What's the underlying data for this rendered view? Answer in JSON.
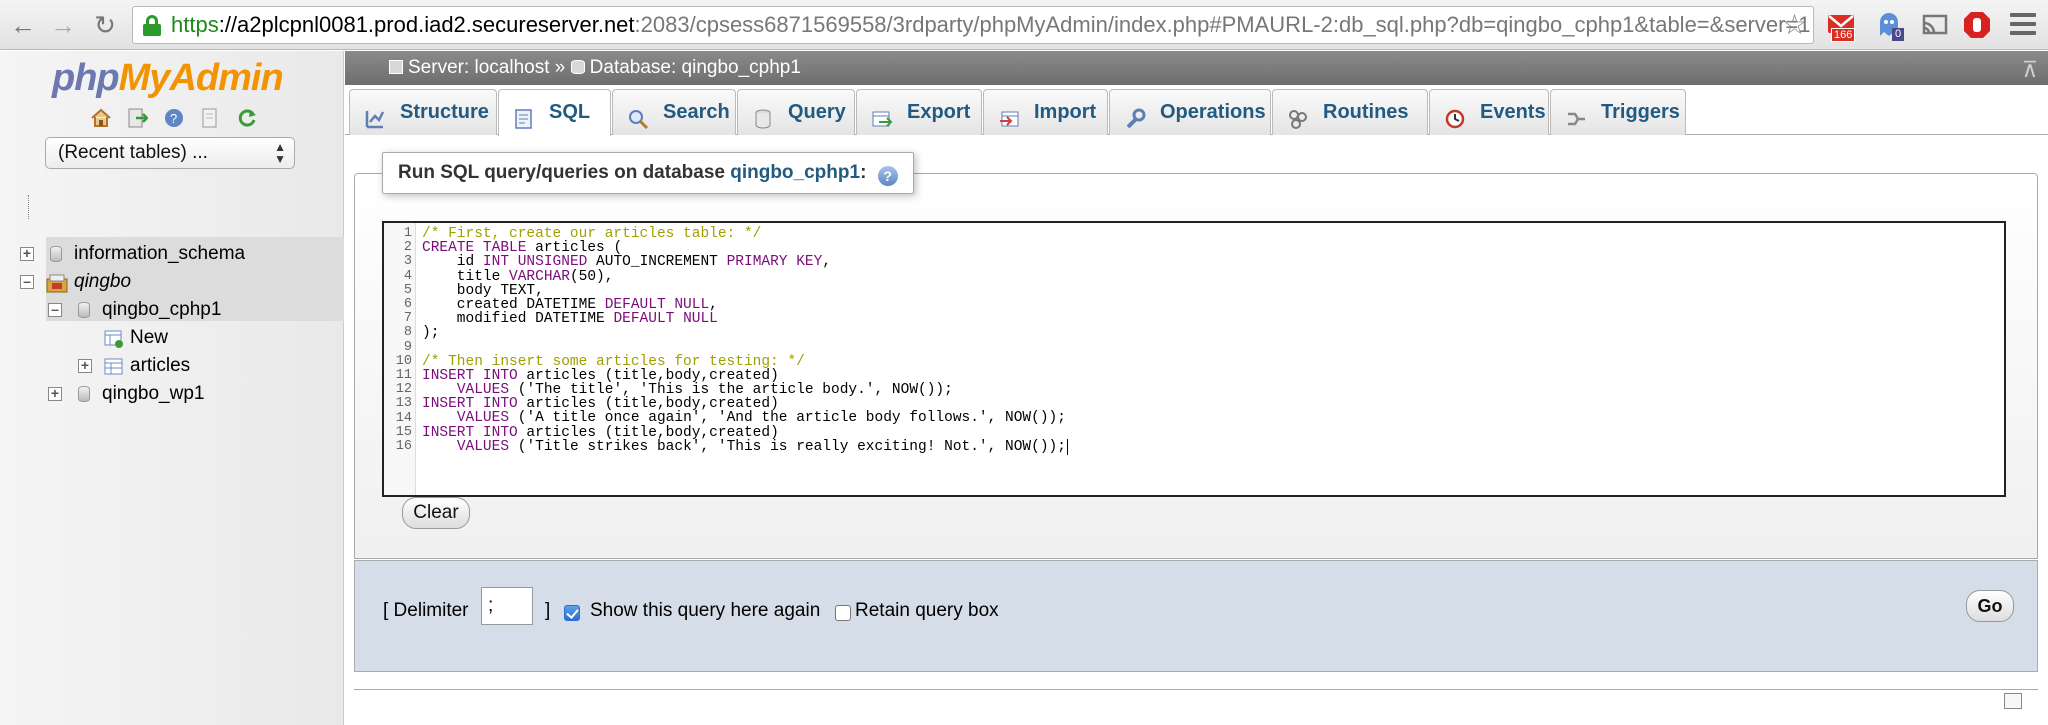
{
  "browser": {
    "url_https": "https",
    "url_host": "://a2plcpnl0081.prod.iad2.secureserver.net",
    "url_rest": ":2083/cpsess6871569558/3rdparty/phpMyAdmin/index.php#PMAURL-2:db_sql.php?db=qingbo_cphp1&table=&server=1…",
    "gmail_badge": "166",
    "ext_badge": "0"
  },
  "logo": {
    "php": "php",
    "my": "My",
    "admin": "Admin"
  },
  "recent_tables": "(Recent tables) ...",
  "tree": {
    "information_schema": "information_schema",
    "qingbo": "qingbo",
    "qingbo_cphp1": "qingbo_cphp1",
    "new": "New",
    "articles": "articles",
    "qingbo_wp1": "qingbo_wp1"
  },
  "breadcrumb": {
    "server": "Server: localhost",
    "sep": "»",
    "database": "Database: qingbo_cphp1"
  },
  "tabs": [
    {
      "label": "Structure",
      "icon": "structure-icon"
    },
    {
      "label": "SQL",
      "icon": "sql-icon"
    },
    {
      "label": "Search",
      "icon": "search-icon"
    },
    {
      "label": "Query",
      "icon": "query-icon"
    },
    {
      "label": "Export",
      "icon": "export-icon"
    },
    {
      "label": "Import",
      "icon": "import-icon"
    },
    {
      "label": "Operations",
      "icon": "wrench-icon"
    },
    {
      "label": "Routines",
      "icon": "routines-icon"
    },
    {
      "label": "Events",
      "icon": "clock-icon"
    },
    {
      "label": "Triggers",
      "icon": "triggers-icon"
    }
  ],
  "sql_panel": {
    "legend_prefix": "Run SQL query/queries on database ",
    "legend_db": "qingbo_cphp1",
    "legend_suffix": ":",
    "help": "?"
  },
  "sql_lines": [
    "/* First, create our articles table: */",
    "CREATE TABLE articles (",
    "    id INT UNSIGNED AUTO_INCREMENT PRIMARY KEY,",
    "    title VARCHAR(50),",
    "    body TEXT,",
    "    created DATETIME DEFAULT NULL,",
    "    modified DATETIME DEFAULT NULL",
    ");",
    "",
    "/* Then insert some articles for testing: */",
    "INSERT INTO articles (title,body,created)",
    "    VALUES ('The title', 'This is the article body.', NOW());",
    "INSERT INTO articles (title,body,created)",
    "    VALUES ('A title once again', 'And the article body follows.', NOW());",
    "INSERT INTO articles (title,body,created)",
    "    VALUES ('Title strikes back', 'This is really exciting! Not.', NOW());"
  ],
  "buttons": {
    "clear": "Clear",
    "go": "Go"
  },
  "options": {
    "delimiter_open": "[ Delimiter",
    "delimiter_value": ";",
    "delimiter_close": "]",
    "show_query": "Show this query here again",
    "retain": "Retain query box"
  },
  "colors": {
    "tab_text": "#235a81",
    "comment": "#a0a000",
    "keyword": "#7a0d7a",
    "options_bg": "#d5dde8"
  }
}
